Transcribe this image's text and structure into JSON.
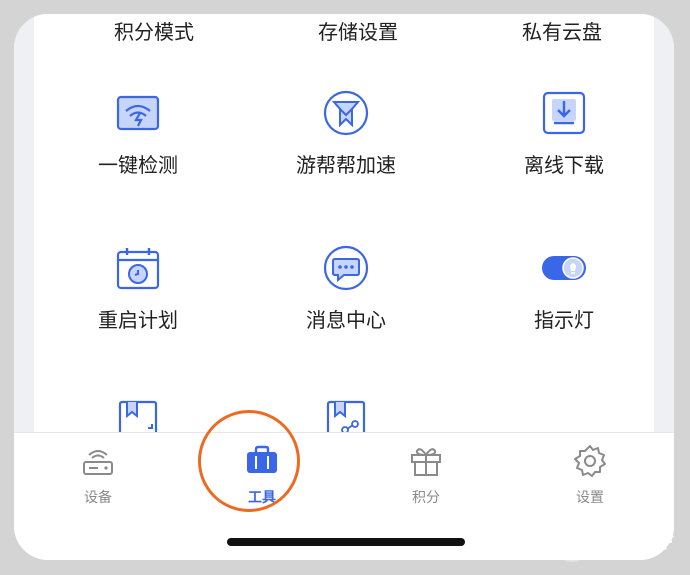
{
  "top_row": [
    "积分模式",
    "存储设置",
    "私有云盘"
  ],
  "grid": [
    {
      "label": "一键检测",
      "icon": "network-check-icon"
    },
    {
      "label": "游帮帮加速",
      "icon": "game-accelerator-icon"
    },
    {
      "label": "离线下载",
      "icon": "offline-download-icon"
    },
    {
      "label": "重启计划",
      "icon": "restart-schedule-icon"
    },
    {
      "label": "消息中心",
      "icon": "message-center-icon"
    },
    {
      "label": "指示灯",
      "icon": "indicator-light-toggle-icon"
    }
  ],
  "tabs": [
    {
      "label": "设备",
      "icon": "router-icon",
      "active": false
    },
    {
      "label": "工具",
      "icon": "toolbox-icon",
      "active": true
    },
    {
      "label": "积分",
      "icon": "gift-icon",
      "active": false
    },
    {
      "label": "设置",
      "icon": "gear-icon",
      "active": false
    }
  ],
  "watermark": {
    "title": "路由器",
    "subtitle": "luyouqi.com"
  },
  "colors": {
    "accent": "#3a66e8",
    "highlight_circle": "#ec6a22"
  }
}
